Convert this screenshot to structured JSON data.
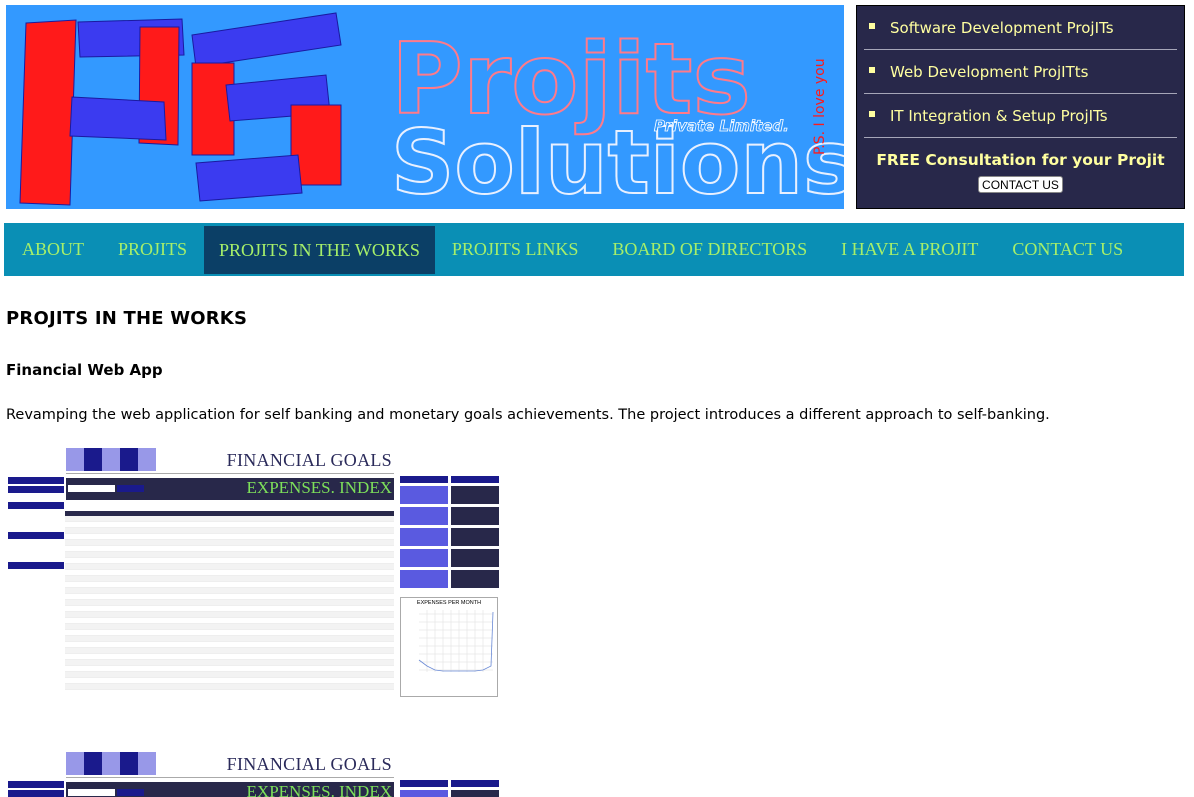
{
  "header": {
    "logo_initials": "PS",
    "logo_line1": "Projits",
    "logo_line2": "Solutions",
    "logo_suffix": "Private Limited.",
    "tagline_vertical": "P.S. I love you",
    "colors": {
      "banner_bg": "#3399ff",
      "block_red": "#ff1a1a",
      "block_blue": "#3b3bf0"
    }
  },
  "side_panel": {
    "items": [
      {
        "label": "Software Development ProjITs"
      },
      {
        "label": "Web Development ProjITts"
      },
      {
        "label": "IT Integration & Setup ProjITs"
      }
    ],
    "consult": "FREE Consultation for your Projit",
    "contact_button": "CONTACT US"
  },
  "nav": {
    "items": [
      {
        "label": "ABOUT"
      },
      {
        "label": "PROJITS"
      },
      {
        "label": "PROJITS IN THE WORKS",
        "active": true
      },
      {
        "label": "PROJITS LINKS"
      },
      {
        "label": "BOARD OF DIRECTORS"
      },
      {
        "label": "I HAVE A PROJIT"
      },
      {
        "label": "CONTACT US"
      }
    ]
  },
  "content": {
    "title": "PROJITS IN THE WORKS",
    "project_title": "Financial Web App",
    "description": "Revamping the web application for self banking and monetary goals achievements. The project introduces a different approach to self-banking."
  },
  "screenshot": {
    "title": "FINANCIAL GOALS",
    "banner": "EXPENSES. INDEX",
    "chart_title": "EXPENSES PER MONTH"
  }
}
